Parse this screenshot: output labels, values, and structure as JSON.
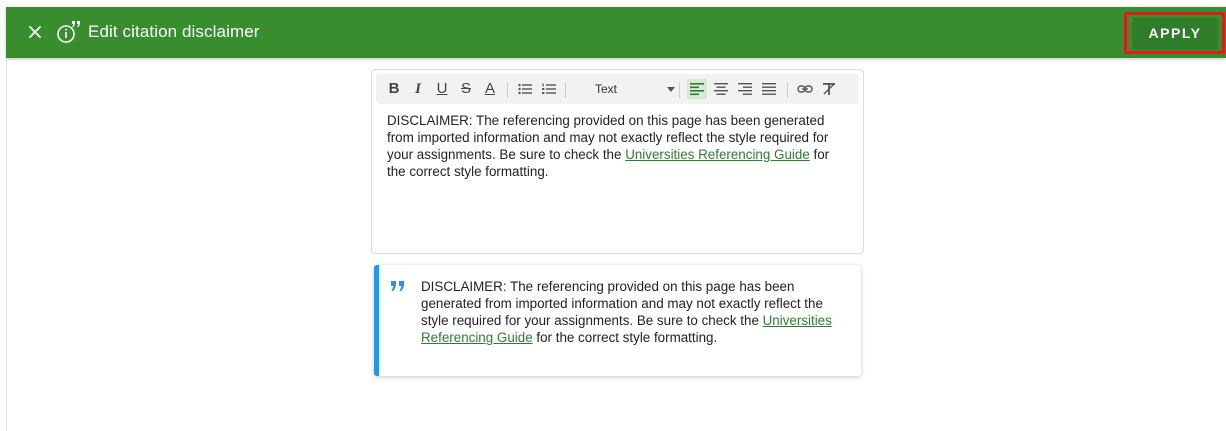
{
  "header": {
    "title": "Edit citation disclaimer",
    "apply_label": "APPLY",
    "close_icon": "close-icon",
    "title_icon": "citation-info-icon",
    "color": "#388e2f"
  },
  "toolbar": {
    "buttons": {
      "bold": "B",
      "italic": "I",
      "underline": "U",
      "strike": "S",
      "font_color": "A"
    },
    "format_select": "Text",
    "active_alignment": "align-left"
  },
  "editor": {
    "text_before_link": "DISCLAIMER: The referencing provided on this page has been generated from imported information and may not exactly reflect the style required for your assignments. Be sure to check the ",
    "link_text": "Universities Referencing Guide",
    "text_after_link": " for the correct style formatting."
  },
  "preview": {
    "text_before_link": "DISCLAIMER: The referencing provided on this page has been generated from imported information and may not exactly reflect the style required for your assignments. Be sure to check the ",
    "link_text": "Universities Referencing Guide",
    "text_after_link": " for the correct style formatting.",
    "accent_color": "#2196f3"
  },
  "link_color": "#2e7d32"
}
